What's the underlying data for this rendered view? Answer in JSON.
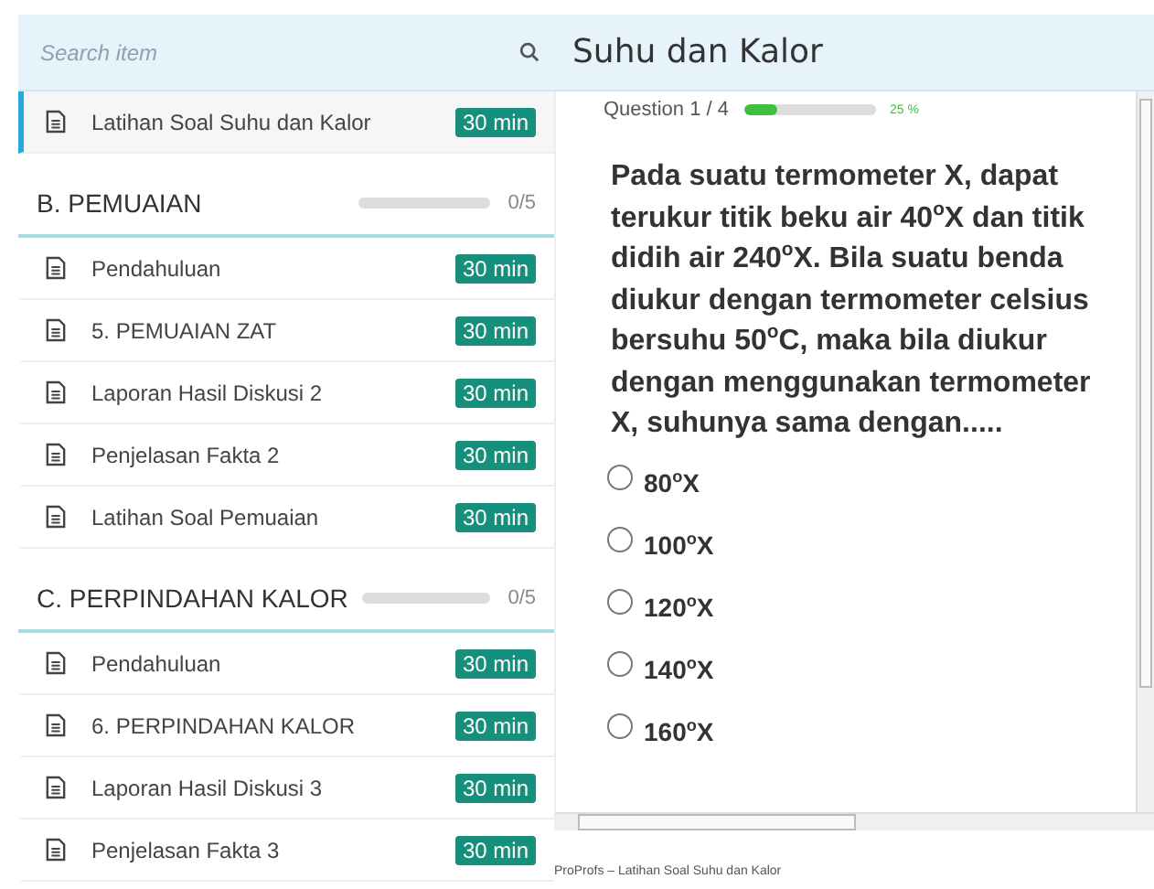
{
  "search": {
    "placeholder": "Search item"
  },
  "course_title": "Suhu dan Kalor",
  "sidebar": [
    {
      "kind": "lesson",
      "label": "Latihan Soal Suhu dan Kalor",
      "duration": "30 min",
      "selected": true
    },
    {
      "kind": "section",
      "label": "B. PEMUAIAN",
      "level": 0,
      "count": "0/5"
    },
    {
      "kind": "lesson",
      "label": "Pendahuluan",
      "duration": "30 min",
      "selected": false
    },
    {
      "kind": "lesson",
      "label": "5. PEMUAIAN ZAT",
      "duration": "30 min",
      "selected": false
    },
    {
      "kind": "lesson",
      "label": "Laporan Hasil Diskusi 2",
      "duration": "30 min",
      "selected": false
    },
    {
      "kind": "lesson",
      "label": "Penjelasan Fakta 2",
      "duration": "30 min",
      "selected": false
    },
    {
      "kind": "lesson",
      "label": "Latihan Soal Pemuaian",
      "duration": "30 min",
      "selected": false
    },
    {
      "kind": "section",
      "label": "C. PERPINDAHAN KALOR",
      "level": 0,
      "count": "0/5"
    },
    {
      "kind": "lesson",
      "label": "Pendahuluan",
      "duration": "30 min",
      "selected": false
    },
    {
      "kind": "lesson",
      "label": "6. PERPINDAHAN KALOR",
      "duration": "30 min",
      "selected": false
    },
    {
      "kind": "lesson",
      "label": "Laporan Hasil Diskusi 3",
      "duration": "30 min",
      "selected": false
    },
    {
      "kind": "lesson",
      "label": "Penjelasan Fakta 3",
      "duration": "30 min",
      "selected": false
    }
  ],
  "quiz": {
    "counter": "Question 1 / 4",
    "level": 0.25,
    "percent": "25 %",
    "question": "Pada suatu termometer X, dapat terukur titik beku air 40$^{o}$X dan titik didih air 240$^{o}$X. Bila suatu benda diukur dengan termometer celsius bersuhu 50$^{o}$C, maka bila diukur dengan menggunakan termometer X, suhunya sama dengan.....",
    "options": [
      {
        "label": "80$^{o}$X",
        "selected": false
      },
      {
        "label": "100$^{o}$X",
        "selected": false
      },
      {
        "label": "120$^{o}$X",
        "selected": false
      },
      {
        "label": "140$^{o}$X",
        "selected": false
      },
      {
        "label": "160$^{o}$X",
        "selected": false
      }
    ]
  },
  "footer": "ProProfs – Latihan Soal Suhu dan Kalor"
}
